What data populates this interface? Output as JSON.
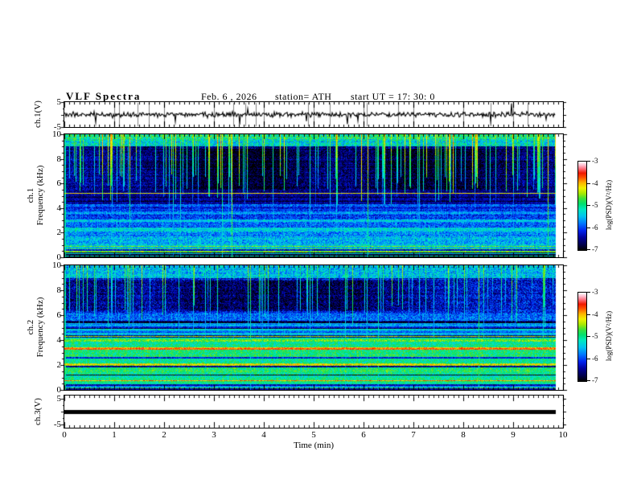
{
  "title": {
    "main": "VLF Spectra",
    "date": "Feb. 6 , 2026",
    "station": "station= ATH",
    "start_ut": "start UT =  17: 30: 0"
  },
  "x_axis": {
    "label": "Time (min)",
    "tick_labels": [
      "0",
      "1",
      "2",
      "3",
      "4",
      "5",
      "6",
      "7",
      "8",
      "9",
      "10"
    ],
    "tick_values": [
      0,
      1,
      2,
      3,
      4,
      5,
      6,
      7,
      8,
      9,
      10
    ],
    "minor_step_min": 0.1,
    "range": [
      0,
      10
    ],
    "data_end_min": 9.85
  },
  "panels": {
    "wave1": {
      "ylabel": "ch.1(V)",
      "ytick_labels": [
        "5",
        "-5"
      ],
      "ytick_values": [
        5,
        -5
      ],
      "ylim": [
        -5,
        5
      ]
    },
    "spec1": {
      "ylabel_ch": "ch.1",
      "ylabel_axis": "Frequency (kHz)",
      "ytick_labels": [
        "10",
        "8",
        "6",
        "4",
        "2",
        "0"
      ],
      "ytick_values": [
        10,
        8,
        6,
        4,
        2,
        0
      ],
      "ylim": [
        0,
        10
      ]
    },
    "spec2": {
      "ylabel_ch": "ch.2",
      "ylabel_axis": "Frequency (kHz)",
      "ytick_labels": [
        "10",
        "8",
        "6",
        "4",
        "2",
        "0"
      ],
      "ytick_values": [
        10,
        8,
        6,
        4,
        2,
        0
      ],
      "ylim": [
        0,
        10
      ]
    },
    "wave3": {
      "ylabel": "ch.3(V)",
      "ytick_labels": [
        "5",
        "-5"
      ],
      "ytick_values": [
        5,
        -5
      ],
      "ylim": [
        -5,
        5
      ]
    }
  },
  "colorbar": {
    "label": "log(PSD)(V²/Hz)",
    "tick_labels": [
      "-3",
      "-4",
      "-5",
      "-6",
      "-7"
    ],
    "tick_values": [
      -3,
      -4,
      -5,
      -6,
      -7
    ],
    "range": [
      -7,
      -3
    ]
  },
  "colormap": [
    [
      0,
      "#000000"
    ],
    [
      0.06,
      "#00004a"
    ],
    [
      0.14,
      "#000099"
    ],
    [
      0.22,
      "#0022ee"
    ],
    [
      0.3,
      "#0077ff"
    ],
    [
      0.38,
      "#00c3f0"
    ],
    [
      0.46,
      "#00e8c0"
    ],
    [
      0.52,
      "#00e070"
    ],
    [
      0.58,
      "#3ae03a"
    ],
    [
      0.64,
      "#a8e800"
    ],
    [
      0.7,
      "#f0f000"
    ],
    [
      0.76,
      "#ffb400"
    ],
    [
      0.82,
      "#ff5000"
    ],
    [
      0.87,
      "#f01800"
    ],
    [
      0.92,
      "#ff7080"
    ],
    [
      0.96,
      "#ffc0d0"
    ],
    [
      1,
      "#ffffff"
    ]
  ],
  "chart_data": [
    {
      "type": "line",
      "name": "ch.1 waveform",
      "units": "V",
      "xlim": [
        0,
        10
      ],
      "ylim": [
        -5,
        5
      ],
      "baseline": 0,
      "noise_sigma": 0.5,
      "spike_rate": 0.02,
      "spike_amp": [
        1.5,
        5
      ],
      "up_spike_frac": 0.25,
      "tall_gray_spikes": 12,
      "gridlines_at_minutes": [
        1,
        2,
        3,
        4,
        5,
        6,
        7,
        8,
        9
      ],
      "data_end_min": 9.85,
      "seed": 20260206
    },
    {
      "type": "heatmap",
      "name": "ch.1 spectrogram",
      "xlim": [
        0,
        10
      ],
      "ylim": [
        0,
        10
      ],
      "zlim": [
        -7,
        -3
      ],
      "seed": 101,
      "bands": [
        [
          0,
          0.08,
          -6.9,
          0.15
        ],
        [
          0.08,
          0.16,
          -5.1,
          0.3
        ],
        [
          0.16,
          0.24,
          -6.9,
          0.2
        ],
        [
          0.24,
          0.32,
          -5.3,
          0.3
        ],
        [
          0.32,
          0.42,
          -6.7,
          0.25
        ],
        [
          0.42,
          0.55,
          -4.6,
          0.25
        ],
        [
          0.55,
          0.63,
          -6.3,
          0.3
        ],
        [
          0.63,
          0.74,
          -4.8,
          0.3
        ],
        [
          0.74,
          0.82,
          -5.6,
          0.3
        ],
        [
          0.82,
          0.92,
          -4.7,
          0.3
        ],
        [
          0.92,
          1.6,
          -5.5,
          0.45
        ],
        [
          1.6,
          2.1,
          -5.65,
          0.45
        ],
        [
          2.1,
          2.4,
          -5.35,
          0.4
        ],
        [
          2.4,
          2.9,
          -5.85,
          0.4
        ],
        [
          2.9,
          3.1,
          -5.45,
          0.35
        ],
        [
          3.1,
          3.5,
          -6.0,
          0.4
        ],
        [
          3.5,
          3.7,
          -5.6,
          0.35
        ],
        [
          3.7,
          4.1,
          -6.15,
          0.35
        ],
        [
          4.1,
          4.3,
          -5.8,
          0.35
        ],
        [
          4.3,
          5.5,
          -6.5,
          0.3
        ],
        [
          5.5,
          9.0,
          -6.45,
          0.4
        ],
        [
          9.0,
          9.6,
          -5.3,
          0.55
        ],
        [
          9.6,
          10,
          -5.0,
          0.55
        ]
      ],
      "lines": [
        [
          4.55,
          -6.9,
          0.04
        ],
        [
          4.85,
          -6.9,
          0.04
        ],
        [
          5.2,
          -4.2,
          0.05
        ]
      ],
      "dark_patches": {
        "f_lo": 5.5,
        "f_hi": 8.8,
        "count": 6,
        "depth": 0.45
      },
      "streaks": {
        "count": 130,
        "f_min": [
          4.2,
          6.8
        ],
        "full_frac": 0.22,
        "v_top": [
          -4.9,
          -3.8
        ],
        "fade": [
          0.1,
          0.3
        ]
      },
      "bright_left_edge": true
    },
    {
      "type": "heatmap",
      "name": "ch.2 spectrogram",
      "xlim": [
        0,
        10
      ],
      "ylim": [
        0,
        10
      ],
      "zlim": [
        -7,
        -3
      ],
      "seed": 202,
      "bands": [
        [
          0,
          0.1,
          -6.6,
          0.3
        ],
        [
          0.1,
          0.2,
          -4.9,
          0.3
        ],
        [
          0.2,
          0.3,
          -5.8,
          0.35
        ],
        [
          0.3,
          0.42,
          -6.4,
          0.3
        ],
        [
          0.42,
          0.56,
          -5.0,
          0.3
        ],
        [
          0.56,
          0.7,
          -4.9,
          0.3
        ],
        [
          0.7,
          0.8,
          -4.3,
          0.35
        ],
        [
          0.8,
          1.15,
          -5.1,
          0.4
        ],
        [
          1.15,
          1.25,
          -6.5,
          0.3
        ],
        [
          1.25,
          1.8,
          -4.95,
          0.4
        ],
        [
          1.8,
          1.95,
          -6.3,
          0.35
        ],
        [
          1.95,
          2.15,
          -4.4,
          0.45
        ],
        [
          2.15,
          2.5,
          -4.95,
          0.35
        ],
        [
          2.5,
          2.62,
          -6.1,
          0.3
        ],
        [
          2.62,
          3.3,
          -4.9,
          0.35
        ],
        [
          3.3,
          3.45,
          -4.0,
          0.4
        ],
        [
          3.45,
          3.9,
          -5.0,
          0.35
        ],
        [
          3.9,
          4.05,
          -4.6,
          0.35
        ],
        [
          4.05,
          4.2,
          -5.15,
          0.3
        ],
        [
          4.2,
          4.38,
          -6.5,
          0.35
        ],
        [
          4.38,
          4.6,
          -5.4,
          0.35
        ],
        [
          4.6,
          4.75,
          -5.9,
          0.3
        ],
        [
          4.75,
          4.92,
          -5.3,
          0.35
        ],
        [
          4.92,
          5.12,
          -6.2,
          0.3
        ],
        [
          5.12,
          5.35,
          -5.6,
          0.35
        ],
        [
          5.35,
          5.52,
          -6.6,
          0.3
        ],
        [
          5.52,
          6.2,
          -5.9,
          0.4
        ],
        [
          6.2,
          9.0,
          -6.25,
          0.45
        ],
        [
          9.0,
          10,
          -5.45,
          0.5
        ]
      ],
      "lines": [
        [
          0.75,
          -3.9,
          0.05
        ],
        [
          1.2,
          -6.8,
          0.04
        ],
        [
          1.87,
          -6.5,
          0.04
        ],
        [
          2.05,
          -4.1,
          0.04
        ],
        [
          3.3,
          -3.7,
          0.06
        ],
        [
          4.3,
          -4.4,
          0.03
        ],
        [
          4.95,
          -6.8,
          0.04
        ],
        [
          5.4,
          -6.9,
          0.04
        ],
        [
          5.48,
          -6.9,
          0.03
        ]
      ],
      "dark_patches": {
        "f_lo": 6.3,
        "f_hi": 8.8,
        "count": 5,
        "depth": 0.5
      },
      "streaks": {
        "count": 85,
        "f_min": [
          5.0,
          6.8
        ],
        "full_frac": 0.3,
        "v_top": [
          -5.2,
          -4.3
        ],
        "fade": [
          0.1,
          0.3
        ]
      },
      "bright_left_edge": true
    },
    {
      "type": "line",
      "name": "ch.3 waveform",
      "units": "V",
      "xlim": [
        0,
        10
      ],
      "ylim": [
        -5,
        5
      ],
      "flat_value": 0,
      "bar_thickness_px": 5,
      "data_end_min": 9.85
    }
  ]
}
